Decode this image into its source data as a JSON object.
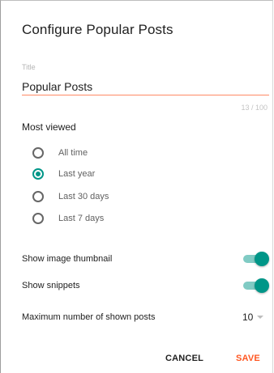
{
  "dialog": {
    "title": "Configure Popular Posts",
    "title_field": {
      "label": "Title",
      "value": "Popular Posts",
      "char_count": "13 / 100"
    },
    "most_viewed": {
      "label": "Most viewed",
      "options": [
        {
          "label": "All time",
          "checked": false
        },
        {
          "label": "Last year",
          "checked": true
        },
        {
          "label": "Last 30 days",
          "checked": false
        },
        {
          "label": "Last 7 days",
          "checked": false
        }
      ]
    },
    "show_thumbnail": {
      "label": "Show image thumbnail",
      "on": true
    },
    "show_snippets": {
      "label": "Show snippets",
      "on": true
    },
    "max_posts": {
      "label": "Maximum number of shown posts",
      "value": "10"
    },
    "buttons": {
      "cancel": "CANCEL",
      "save": "SAVE"
    }
  },
  "colors": {
    "accent": "#009688",
    "accent_light": "#80cbc4",
    "save": "#ff5722",
    "underline": "#ff8a65"
  },
  "icons": {
    "select_caret": "triangle-down-icon"
  }
}
